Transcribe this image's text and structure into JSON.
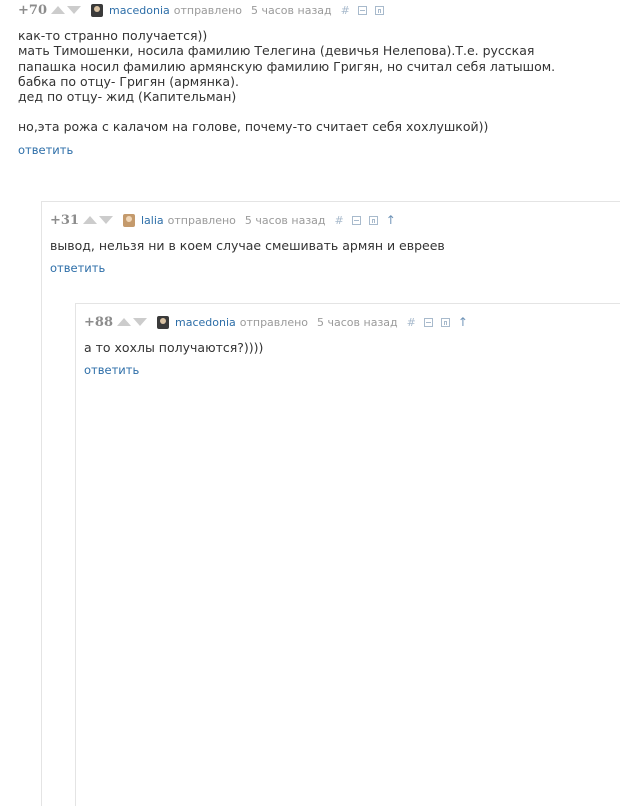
{
  "comments": [
    {
      "rating": "+70",
      "user": "macedonia",
      "sent_label": "отправлено",
      "time": "5 часов назад",
      "icons": [
        "hash-icon",
        "collapse-icon",
        "save-icon"
      ],
      "lines": [
        "как-то странно получается))",
        "мать Тимошенки, носила фамилию Телегина (девичья Нелепова).Т.е. русская",
        "папашка носил фамилию армянскую фамилию Григян, но считал себя латышом.",
        "бабка по отцу- Григян (армянка).",
        "дед по отцу- жид (Капительман)",
        "",
        "но,эта рожа с калачом на голове, почему-то считает себя хохлушкой))"
      ],
      "reply": "ответить"
    },
    {
      "rating": "+31",
      "user": "lalia",
      "sent_label": "отправлено",
      "time": "5 часов назад",
      "icons": [
        "hash-icon",
        "collapse-icon",
        "save-icon",
        "parent-arrow-icon"
      ],
      "lines": [
        "вывод, нельзя ни в коем случае смешивать армян и евреев"
      ],
      "reply": "ответить"
    },
    {
      "rating": "+88",
      "user": "macedonia",
      "sent_label": "отправлено",
      "time": "5 часов назад",
      "icons": [
        "hash-icon",
        "collapse-icon",
        "save-icon",
        "parent-arrow-icon"
      ],
      "lines": [
        "а то хохлы получаются?))))"
      ],
      "reply": "ответить"
    }
  ],
  "colors": {
    "link": "#2d6ea8",
    "meta": "#9a9a9a",
    "rating": "#8c8c8c",
    "vote_arrow": "#cccccc",
    "icon": "#a8bacc"
  }
}
